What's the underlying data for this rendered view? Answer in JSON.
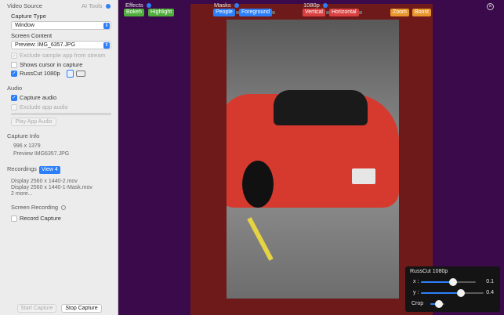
{
  "sidebar": {
    "video_source_title": "Video Source",
    "ai_tools_label": "AI Tools",
    "capture_type_label": "Capture Type",
    "capture_type_value": "Window",
    "screen_content_label": "Screen Content",
    "screen_content_value": "Preview: IMG_6357.JPG",
    "exclude_sample_label": "Exclude sample app from stream",
    "shows_cursor_label": "Shows cursor in capture",
    "russcut_label": "RussCut 1080p",
    "audio_title": "Audio",
    "capture_audio_label": "Capture audio",
    "exclude_app_audio_label": "Exclude app audio",
    "play_app_audio_label": "Play App Audio",
    "capture_info_title": "Capture Info",
    "capture_dims": "996 x 1379",
    "capture_name": "Preview IMG6357.JPG",
    "recordings_title": "Recordings",
    "view_label": "View 4",
    "recording_files": [
      "Display 2560 x 1440-2.mov",
      "Display 2560 x 1440-1-Mask.mov",
      "2 more..."
    ],
    "screen_recording_title": "Screen Recording",
    "record_capture_label": "Record Capture",
    "start_capture_label": "Start Capture",
    "stop_capture_label": "Stop Capture"
  },
  "toolbar": {
    "effects_label": "Effects",
    "bokeh_label": "Bokeh",
    "highlight_label": "Highlight",
    "masks_label": "Masks",
    "people_label": "People",
    "foreground_label": "Foreground",
    "res_label": "1080p",
    "vertical_label": "Vertical",
    "horizontal_label": "Horizontal",
    "zoom_label": "Zoom",
    "boost_label": "Boost"
  },
  "panel": {
    "title": "RussCut 1080p",
    "x_label": "x :",
    "x_value": "0.1",
    "y_label": "y :",
    "y_value": "0.4",
    "crop_label": "Crop"
  },
  "colors": {
    "accent": "#2d7ff9",
    "green": "#4fae3c",
    "red": "#d94141",
    "orange": "#e8952b",
    "purple_bg": "#3a0a4a",
    "preview_red": "#6e1a1a"
  }
}
